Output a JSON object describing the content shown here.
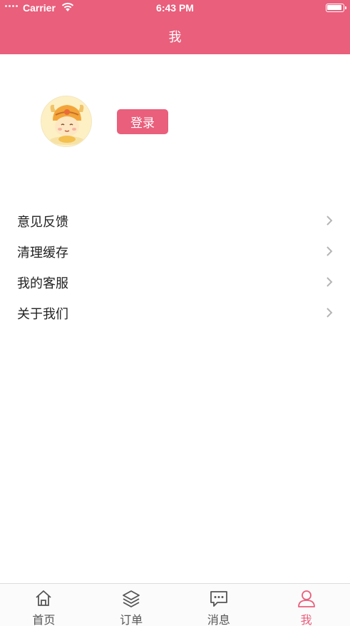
{
  "status_bar": {
    "carrier": "Carrier",
    "time": "6:43 PM"
  },
  "header": {
    "title": "我"
  },
  "profile": {
    "login_label": "登录"
  },
  "menu": {
    "items": [
      {
        "label": "意见反馈"
      },
      {
        "label": "清理缓存"
      },
      {
        "label": "我的客服"
      },
      {
        "label": "关于我们"
      }
    ]
  },
  "tabbar": {
    "tabs": [
      {
        "label": "首页",
        "icon": "home-icon"
      },
      {
        "label": "订单",
        "icon": "layers-icon"
      },
      {
        "label": "消息",
        "icon": "message-icon"
      },
      {
        "label": "我",
        "icon": "user-icon",
        "active": true
      }
    ]
  },
  "colors": {
    "accent": "#E95F7C",
    "text": "#222222",
    "tab_inactive": "#555555"
  }
}
